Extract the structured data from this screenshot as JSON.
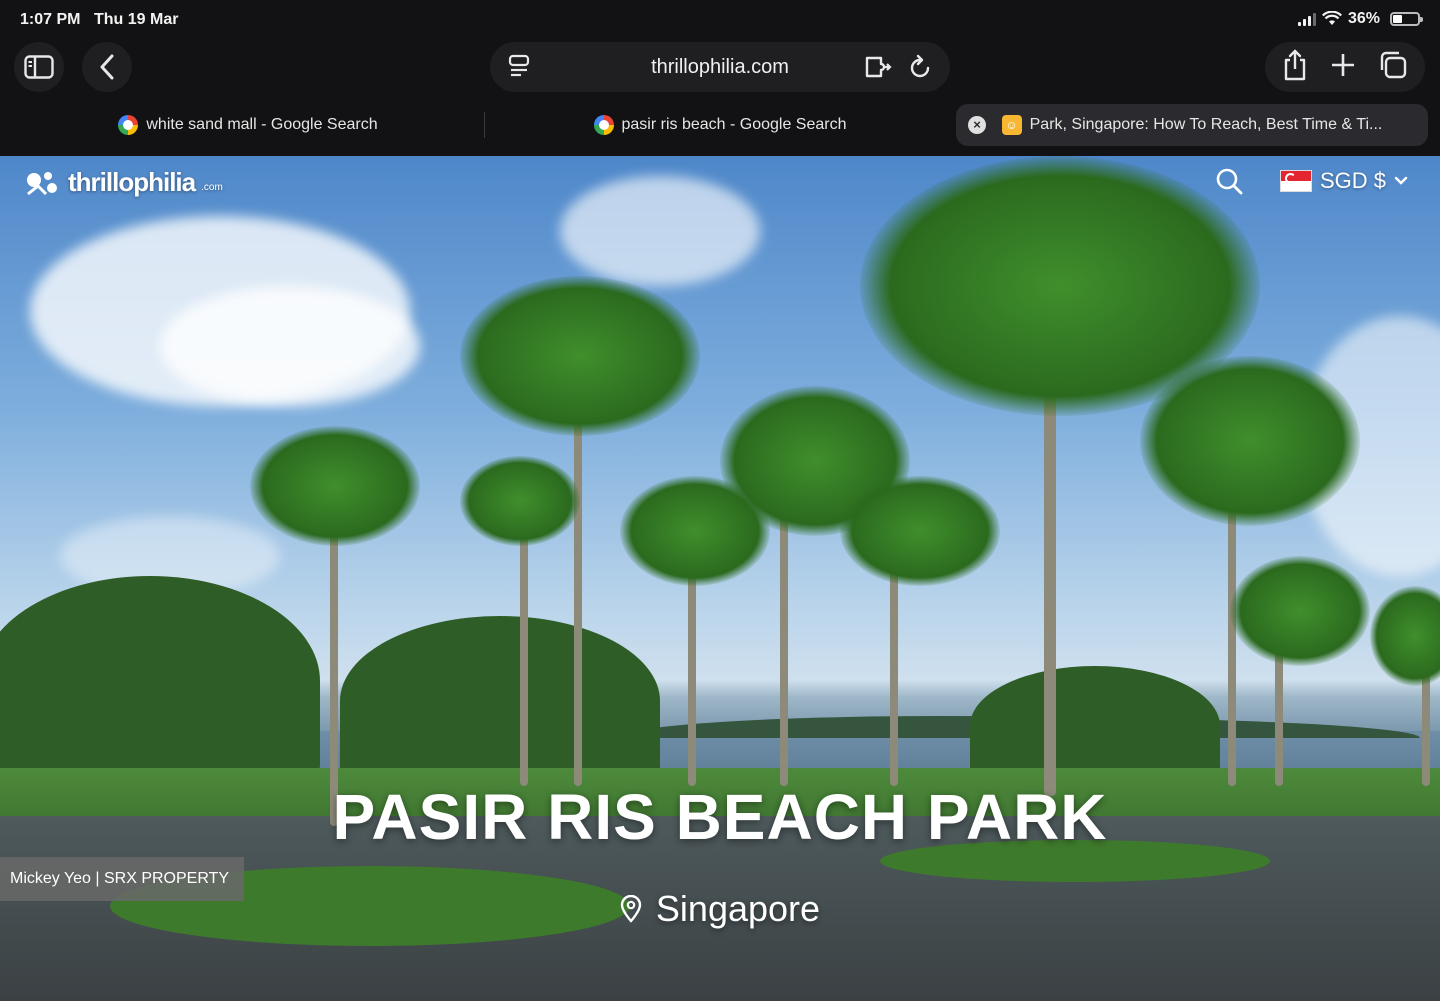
{
  "status_bar": {
    "time": "1:07 PM",
    "date": "Thu 19 Mar",
    "battery": "36%",
    "battery_fraction": 0.36
  },
  "address_bar": {
    "url": "thrillophilia.com"
  },
  "tabs": [
    {
      "title": "white sand mall - Google Search",
      "favicon": "google-icon",
      "active": false
    },
    {
      "title": "pasir ris beach - Google Search",
      "favicon": "google-icon",
      "active": false
    },
    {
      "title": "Park, Singapore: How To Reach, Best Time & Ti...",
      "favicon": "thrillophilia-icon",
      "active": true
    }
  ],
  "site": {
    "logo_text": "thrillophilia",
    "logo_suffix": ".com",
    "currency": "SGD $"
  },
  "hero": {
    "title": "PASIR RIS BEACH PARK",
    "location": "Singapore"
  },
  "watermark": "Mickey Yeo | SRX PROPERTY",
  "colors": {
    "chrome_bg": "#121214",
    "tab_active": "#2b2b2f",
    "sky": "#7eaedd",
    "grass": "#3e7430"
  }
}
